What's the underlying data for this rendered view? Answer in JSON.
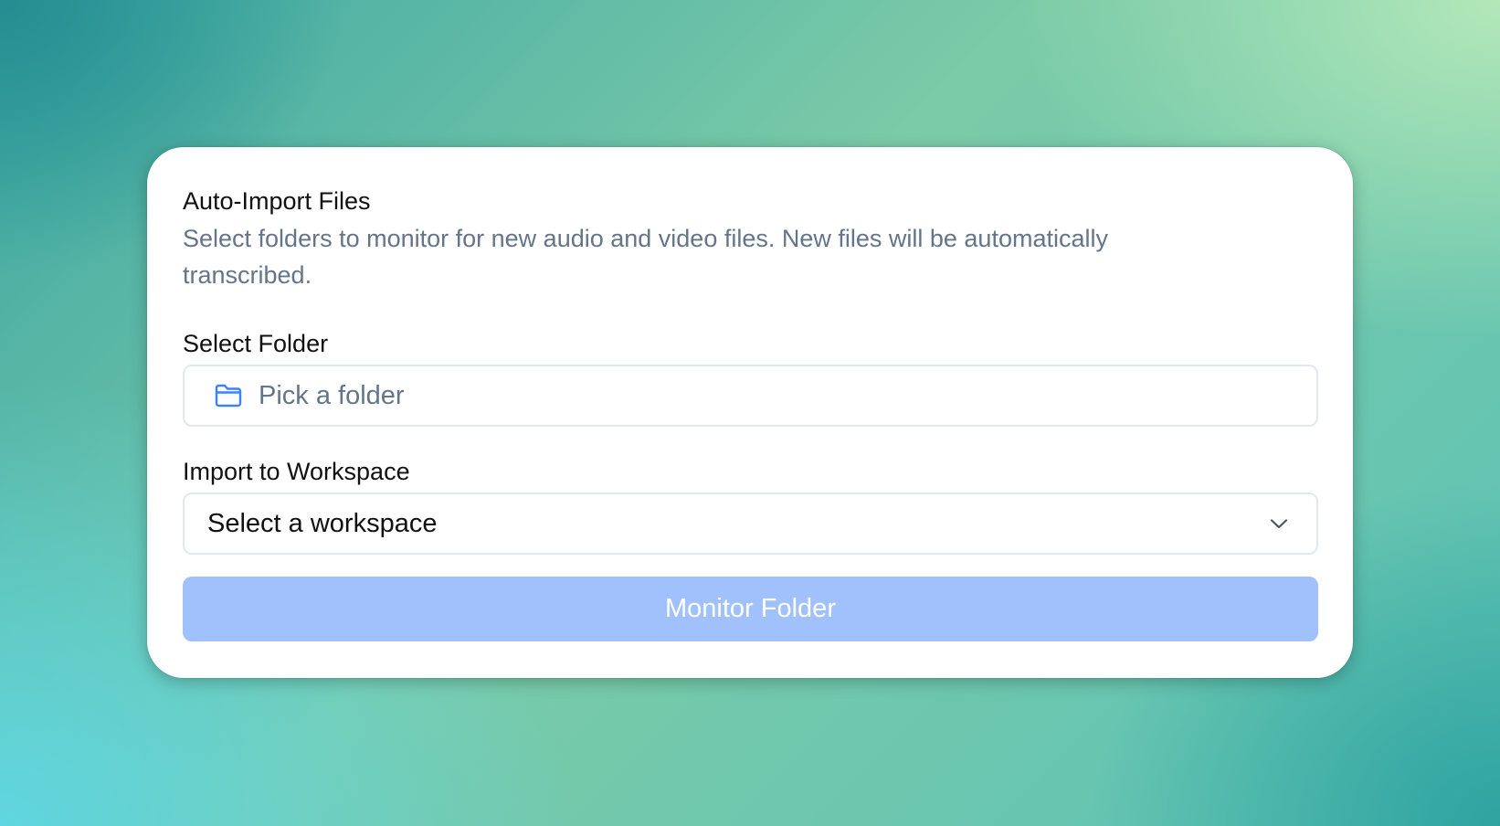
{
  "card": {
    "title": "Auto-Import Files",
    "description": "Select folders to monitor for new audio and video files. New files will be automatically transcribed."
  },
  "folder": {
    "label": "Select Folder",
    "placeholder": "Pick a folder",
    "icon": "folder-icon"
  },
  "workspace": {
    "label": "Import to Workspace",
    "selected_value": "Select a workspace",
    "icon": "chevron-down-icon"
  },
  "action": {
    "label": "Monitor Folder",
    "state": "disabled"
  },
  "colors": {
    "accent": "#3b82f6",
    "button_disabled": "#a0c1fb",
    "muted_text": "#64748b"
  }
}
